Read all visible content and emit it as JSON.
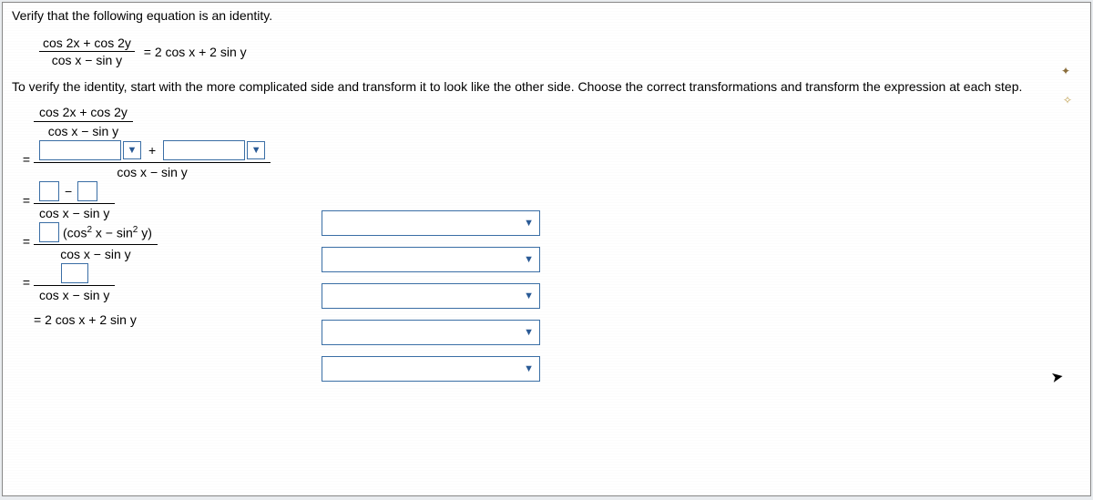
{
  "prompt": "Verify that the following equation is an identity.",
  "equation": {
    "numerator": "cos 2x + cos 2y",
    "denominator": "cos x − sin y",
    "rhs": "= 2 cos x + 2 sin y"
  },
  "instruction": "To verify the identity, start with the more complicated side and transform it to look like the other side. Choose the correct transformations and transform the expression at each step.",
  "start": {
    "numerator": "cos 2x + cos 2y",
    "denominator": "cos x − sin y"
  },
  "step1": {
    "plus": "+",
    "denominator": "cos x − sin y"
  },
  "step2": {
    "num_between": "−",
    "denominator": "cos x − sin y"
  },
  "step3": {
    "num_text": "(cos ² x − sin ² y)",
    "denominator": "cos x − sin y"
  },
  "step4": {
    "denominator": "cos x − sin y"
  },
  "result": "= 2 cos x + 2 sin y",
  "eq_symbol": "=",
  "dropdown_glyph": "▼"
}
